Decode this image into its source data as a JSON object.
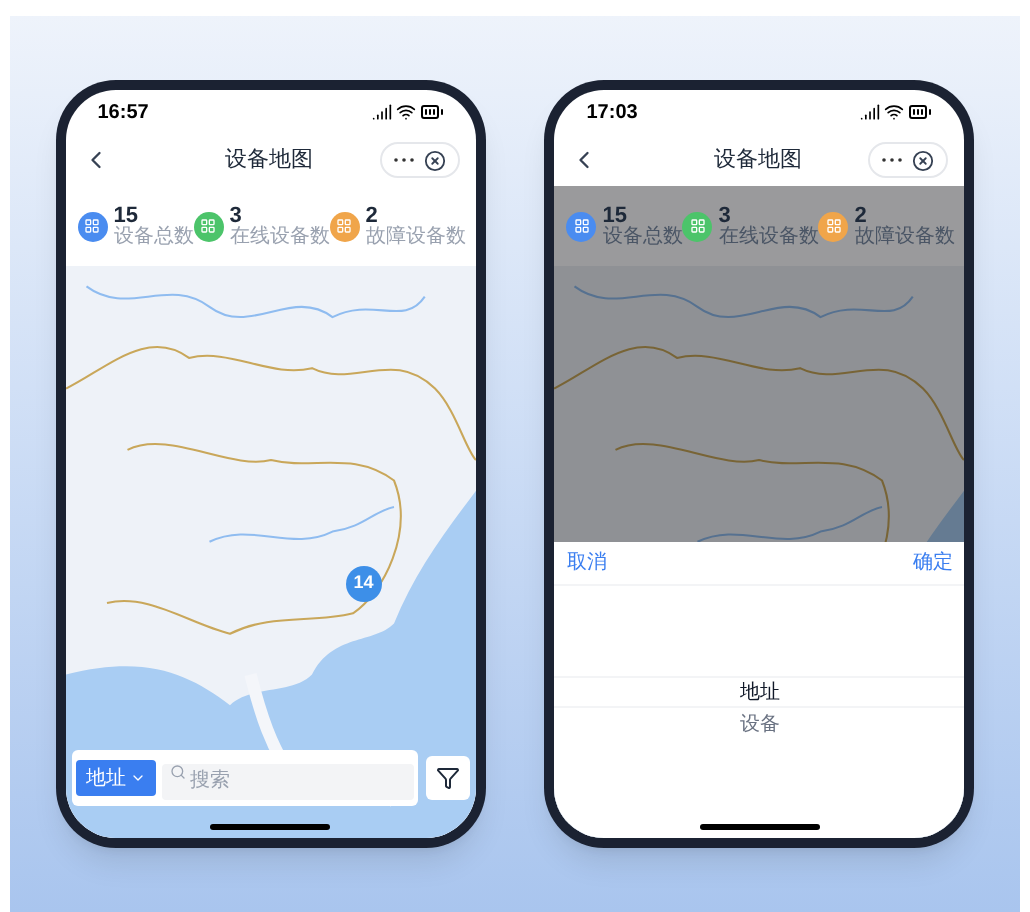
{
  "phones": [
    {
      "status_time": "16:57",
      "nav_title": "设备地图",
      "stats": [
        {
          "value": "15",
          "label": "设备总数",
          "color": "#4a8cf0"
        },
        {
          "value": "3",
          "label": "在线设备数",
          "color": "#4cc46a"
        },
        {
          "value": "2",
          "label": "故障设备数",
          "color": "#f0a54a"
        }
      ],
      "map_marker": "14",
      "search": {
        "type_button": "地址",
        "placeholder": "搜索"
      }
    },
    {
      "status_time": "17:03",
      "nav_title": "设备地图",
      "stats": [
        {
          "value": "15",
          "label": "设备总数",
          "color": "#4a8cf0"
        },
        {
          "value": "3",
          "label": "在线设备数",
          "color": "#4cc46a"
        },
        {
          "value": "2",
          "label": "故障设备数",
          "color": "#f0a54a"
        }
      ],
      "picker": {
        "cancel": "取消",
        "confirm": "确定",
        "options": [
          {
            "label": "地址",
            "selected": true
          },
          {
            "label": "设备",
            "selected": false
          }
        ]
      }
    }
  ]
}
